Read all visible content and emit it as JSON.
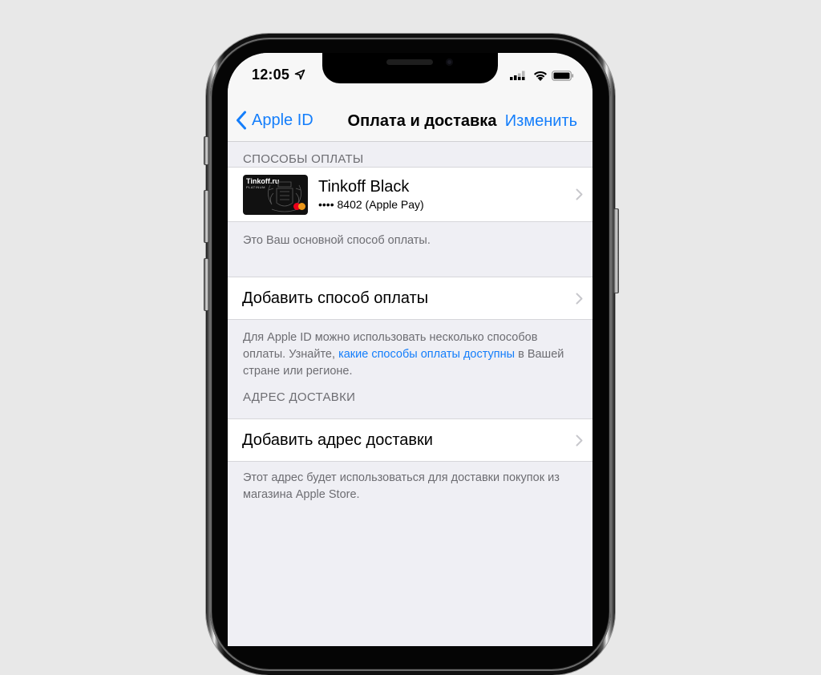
{
  "status_bar": {
    "time": "12:05",
    "icons": [
      "location-arrow-icon",
      "cellular-signal-icon",
      "wifi-icon",
      "battery-icon"
    ]
  },
  "nav": {
    "back_label": "Apple ID",
    "title": "Оплата и доставка",
    "edit_label": "Изменить"
  },
  "payment_section": {
    "header": "СПОСОБЫ ОПЛАТЫ",
    "card": {
      "brand_on_card": "Tinkoff.ru",
      "tier_on_card": "PLATINUM",
      "name": "Tinkoff Black",
      "number": "•••• 8402 (Apple Pay)"
    },
    "card_footer": "Это Ваш основной способ оплаты.",
    "add_payment_label": "Добавить способ оплаты",
    "info_text_before": "Для Apple ID можно использовать несколько способов оплаты. Узнайте, ",
    "info_link": "какие способы оплаты доступны",
    "info_text_after": " в Вашей стране или регионе."
  },
  "shipping_section": {
    "header": "АДРЕС ДОСТАВКИ",
    "add_address_label": "Добавить адрес доставки",
    "footer": "Этот адрес будет использоваться для доставки покупок из магазина Apple Store."
  },
  "colors": {
    "accent": "#147efb",
    "background": "#efeff4",
    "secondary_text": "#6d6d72"
  }
}
